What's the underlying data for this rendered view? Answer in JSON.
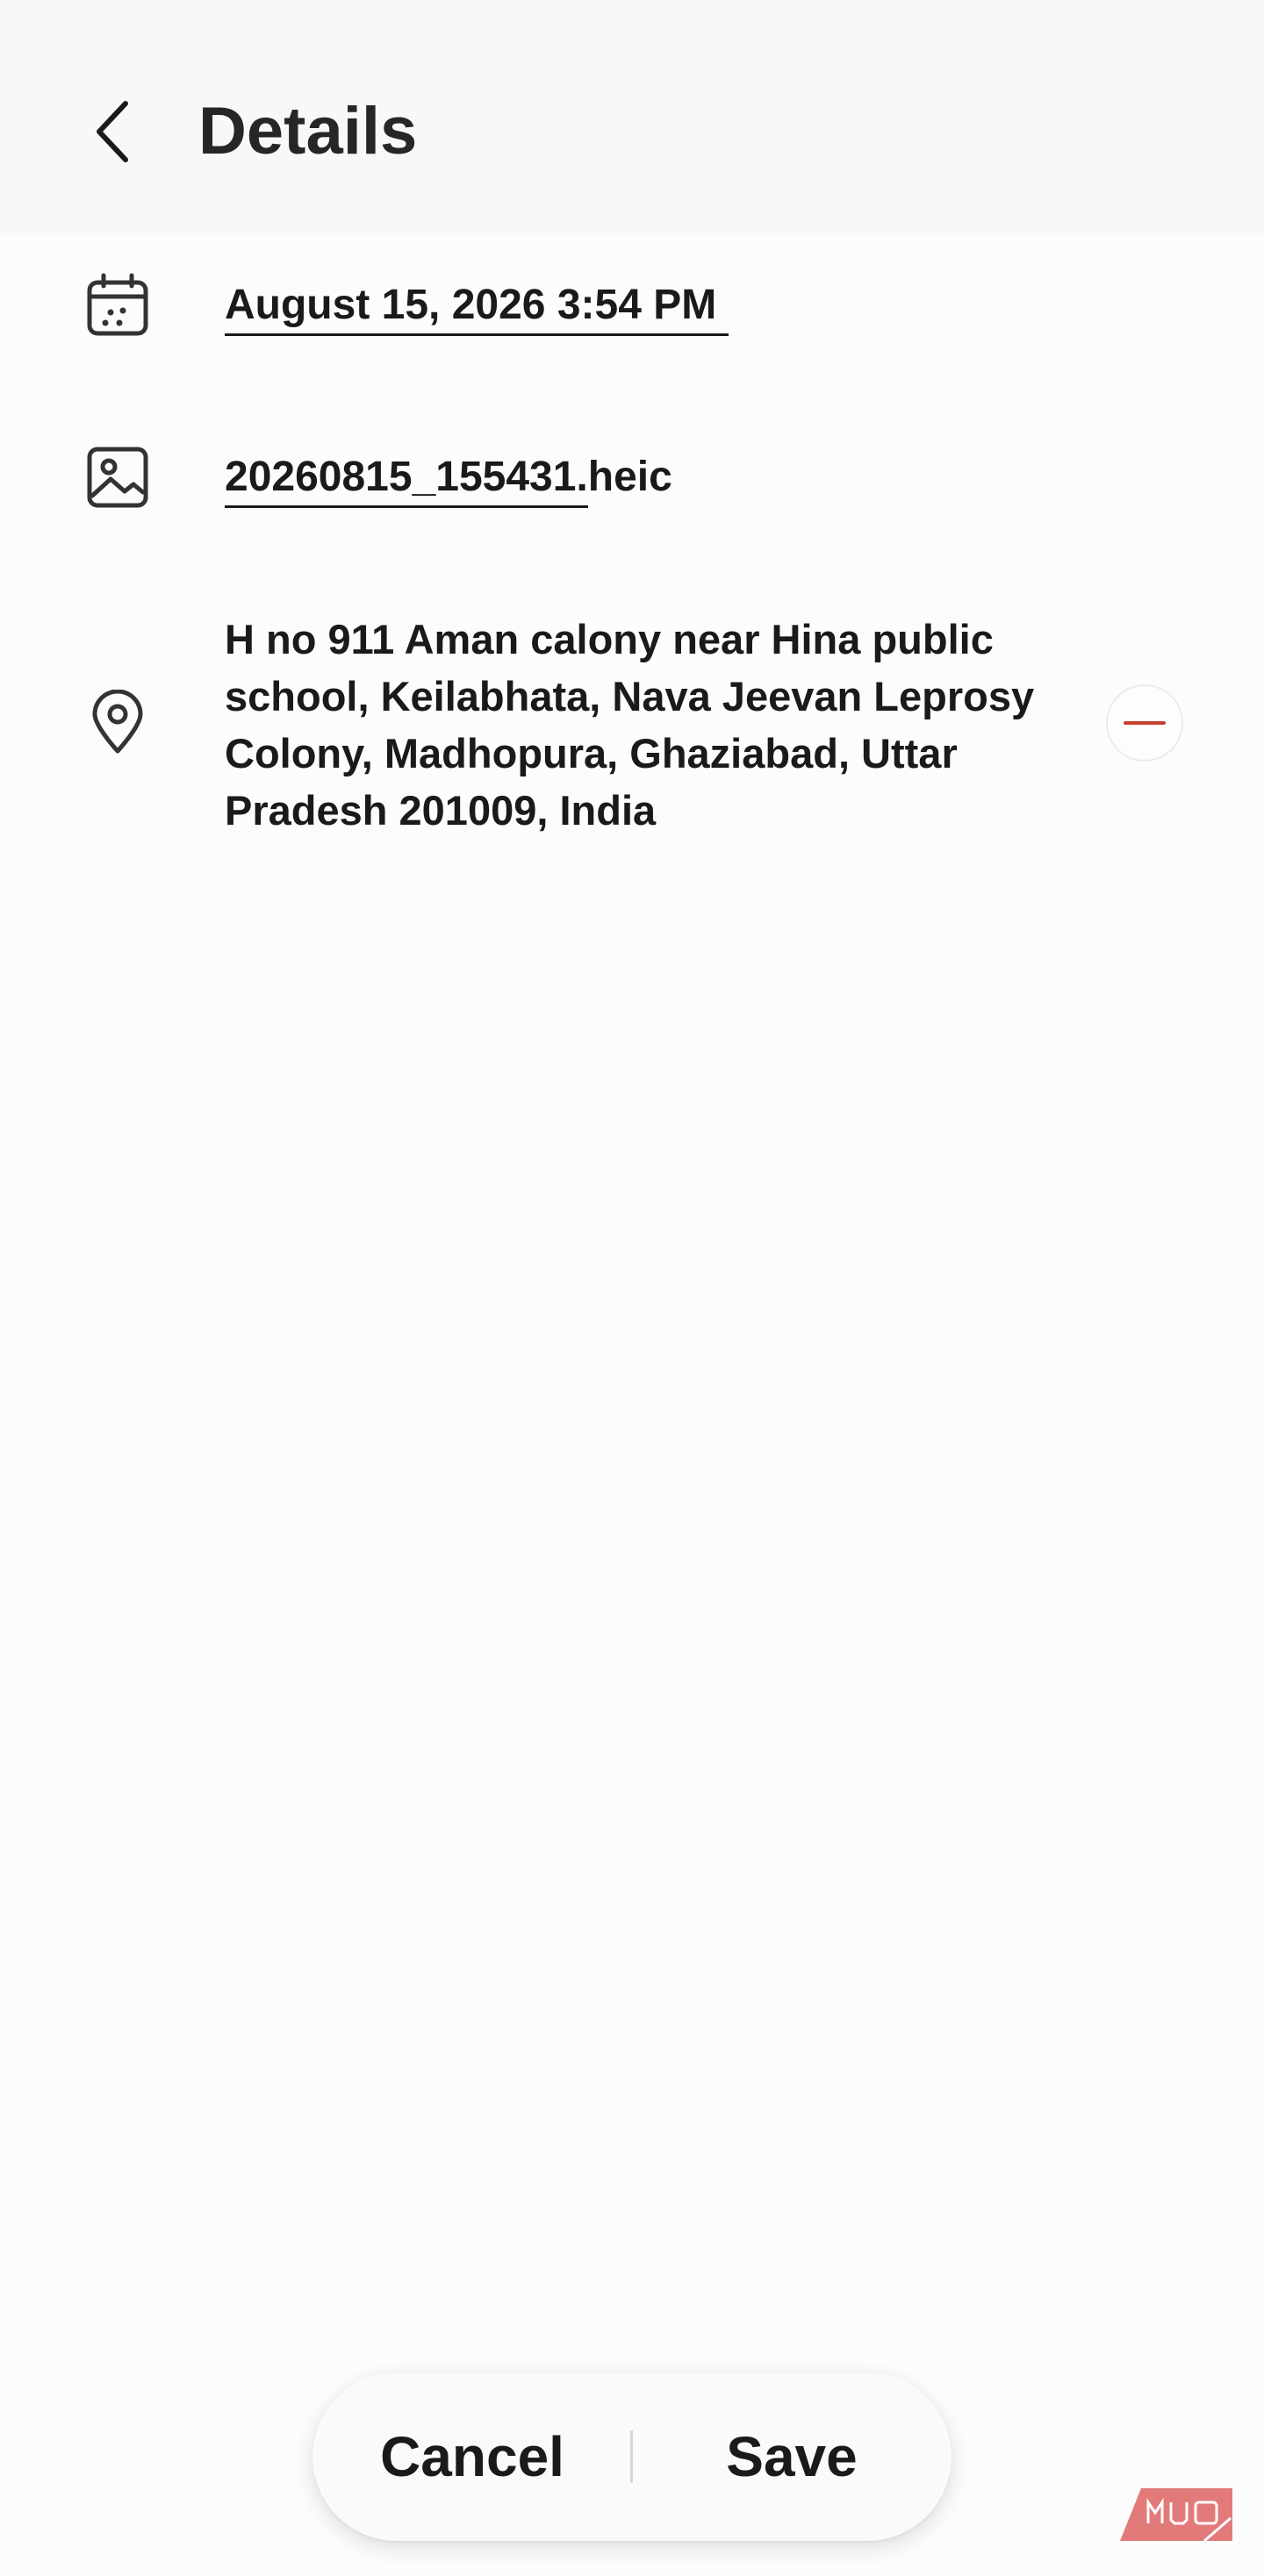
{
  "header": {
    "back_icon": "chevron-left-icon",
    "title": "Details"
  },
  "details": {
    "date": {
      "icon": "calendar-icon",
      "value": "August 15, 2026 3:54 PM"
    },
    "file": {
      "icon": "image-icon",
      "name_editable": "20260815_155431",
      "extension": ".heic"
    },
    "location": {
      "icon": "location-pin-icon",
      "address": "H no 911 Aman calony near Hina public school, Keilabhata, Nava Jeevan Leprosy Colony, Madhopura, Ghaziabad, Uttar Pradesh 201009, India",
      "remove_icon": "minus-icon"
    }
  },
  "actions": {
    "cancel_label": "Cancel",
    "save_label": "Save"
  },
  "watermark": {
    "text": "MUO"
  },
  "colors": {
    "remove_accent": "#c3402f",
    "watermark": "#e06b6b"
  }
}
